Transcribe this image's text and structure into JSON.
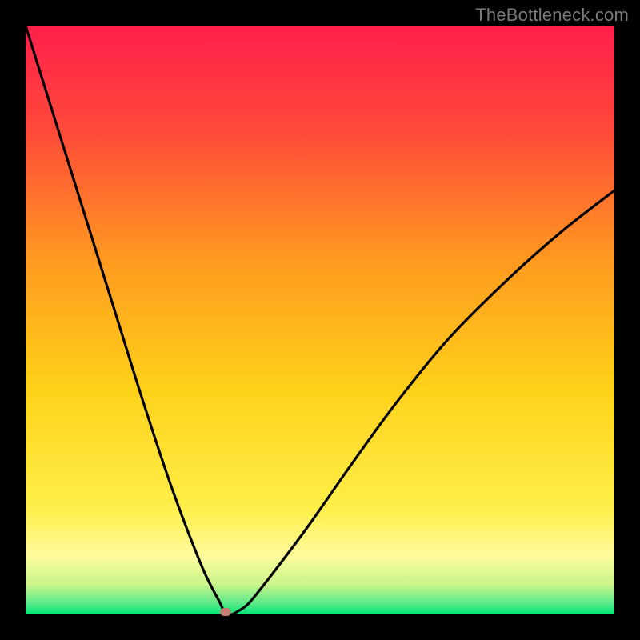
{
  "watermark": "TheBottleneck.com",
  "colors": {
    "frame": "#000000",
    "watermark": "#7a7a7a",
    "gradient_top": "#ff1f4b",
    "gradient_mid": "#ffd21a",
    "gradient_yellowband": "#fffa9c",
    "gradient_green": "#00e676",
    "curve": "#000000",
    "marker": "#c77c74"
  },
  "chart_data": {
    "type": "line",
    "title": "",
    "xlabel": "",
    "ylabel": "",
    "xlim": [
      0,
      100
    ],
    "ylim": [
      0,
      100
    ],
    "x": [
      0,
      5,
      10,
      15,
      20,
      25,
      30,
      33,
      34,
      35,
      36,
      38,
      42,
      48,
      55,
      63,
      72,
      82,
      91,
      100
    ],
    "y": [
      100,
      84,
      68,
      52,
      36,
      21,
      8,
      2,
      0,
      0,
      0.5,
      2,
      7,
      15,
      25,
      36,
      47,
      57,
      65,
      72
    ],
    "marker": {
      "x": 34,
      "y": 0
    },
    "notes": "V-shaped curve on red→orange→yellow→green vertical gradient; minimum near x≈34. Values estimated from pixels."
  }
}
